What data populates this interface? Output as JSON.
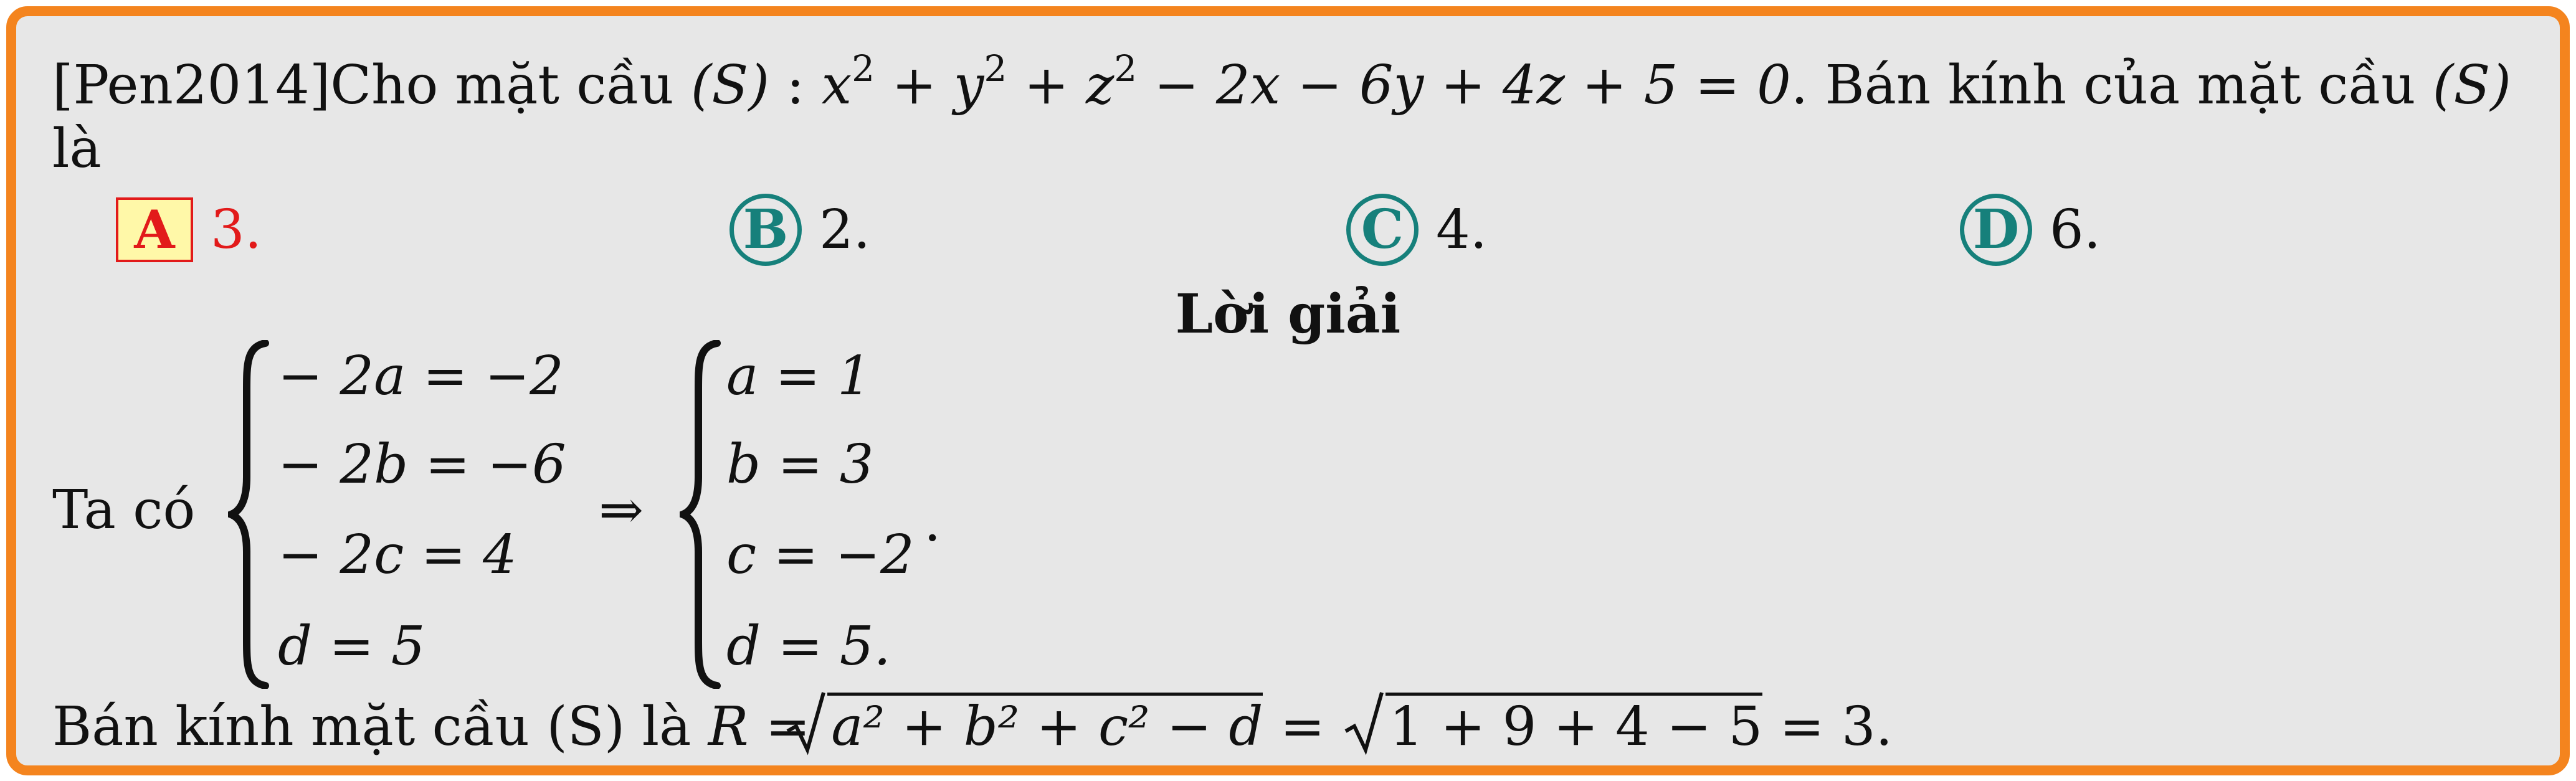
{
  "question": {
    "prefix": "[Pen2014]Cho mặt cầu",
    "s_label": "(S)",
    "colon": ":",
    "equation_parts": [
      "x",
      "2",
      " + y",
      "2",
      " + z",
      "2",
      " − 2x − 6y + 4z + 5 = 0"
    ],
    "suffix": ". Bán kính của mặt cầu",
    "s_label_end": "(S)",
    "line2": "là"
  },
  "choices": [
    {
      "letter": "A",
      "text": "3.",
      "correct": true
    },
    {
      "letter": "B",
      "text": "2.",
      "correct": false
    },
    {
      "letter": "C",
      "text": "4.",
      "correct": false
    },
    {
      "letter": "D",
      "text": "6.",
      "correct": false
    }
  ],
  "solution": {
    "heading": "Lời giải",
    "ta_co": "Ta có",
    "left_system": [
      "− 2a = −2",
      "− 2b = −6",
      "− 2c = 4",
      "d = 5"
    ],
    "implies": "⇒",
    "right_system": [
      "a = 1",
      "b = 3",
      "c = −2",
      "d = 5."
    ],
    "after_system": ".",
    "radius_prefix": "Bán kính mặt cầu (S) là",
    "radius_r": "R =",
    "radius_sqrt1": "a² + b² + c² − d",
    "radius_eq": "=",
    "radius_sqrt2": "1 + 9 + 4 − 5",
    "radius_result": "= 3."
  },
  "colors": {
    "border": "#f4841e",
    "background": "#e7e7e7",
    "correct": "#e21a1a",
    "choice_circle": "#16807b",
    "highlight": "#fff8a8"
  }
}
